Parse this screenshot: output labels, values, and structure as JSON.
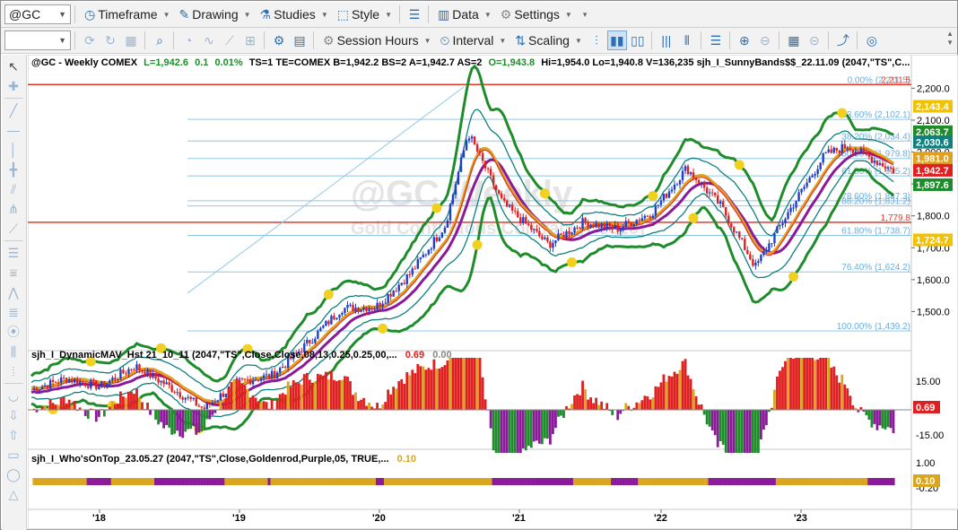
{
  "toolbar1": {
    "symbol": "@GC",
    "items": [
      {
        "label": "Timeframe",
        "icon": "clock-icon"
      },
      {
        "label": "Drawing",
        "icon": "pencil-icon"
      },
      {
        "label": "Studies",
        "icon": "flask-icon"
      },
      {
        "label": "Style",
        "icon": "style-icon"
      },
      {
        "label": "Data",
        "icon": "data-icon"
      },
      {
        "label": "Settings",
        "icon": "gear-icon"
      }
    ]
  },
  "toolbar2": {
    "combo_value": "",
    "items": [
      {
        "label": "Session Hours",
        "icon": "gear-icon"
      },
      {
        "label": "Interval",
        "icon": "interval-icon"
      },
      {
        "label": "Scaling",
        "icon": "scaling-icon"
      }
    ]
  },
  "header": {
    "symbol_text": "@GC - Weekly  COMEX",
    "last": "L=1,942.6",
    "chg": "0.1",
    "pct": "0.01%",
    "rest": "TS=1  TE=COMEX  B=1,942.2  BS=2  A=1,942.7  AS=2",
    "open": "O=1,943.8",
    "rest2": "Hi=1,954.0  Lo=1,940.8  V=136,235  sjh_I_SunnyBands$$_22.11.09 (2047,\"TS\",C..."
  },
  "watermark": {
    "line1": "@GC Weekly",
    "line2": "Gold Continuous Contract [Dec23]"
  },
  "fib_levels": [
    {
      "label": "0.00% (2,211.5)",
      "value": 2211.5
    },
    {
      "label": "23.60% (2,102.1)",
      "value": 2102.1
    },
    {
      "label": "38.20% (2,034.4)",
      "value": 2034.4
    },
    {
      "label": "50.00% (1,979.8)",
      "value": 1979.8
    },
    {
      "label": "61.80% (1,925.2)",
      "value": 1925.2
    },
    {
      "label": "78.60% (1,847.3)",
      "value": 1847.3
    },
    {
      "label": "88.20% (1,831.2)",
      "value": 1831.2
    },
    {
      "label": "61.80% (1,738.7)",
      "value": 1738.7
    },
    {
      "label": "76.40% (1,624.2)",
      "value": 1624.2
    },
    {
      "label": "100.00% (1,439.2)",
      "value": 1439.2
    }
  ],
  "hlines": [
    {
      "label": "2,211.5",
      "value": 2211.5,
      "color": "#e8382b"
    },
    {
      "label": "1,779.8",
      "value": 1779.8,
      "color": "#e8382b"
    }
  ],
  "price_axis": {
    "ticks": [
      "2,200.0",
      "2,100.0",
      "2,000.0",
      "1,900.0",
      "1,800.0",
      "1,700.0",
      "1,600.0",
      "1,500.0"
    ],
    "tick_values": [
      2200,
      2100,
      2000,
      1900,
      1800,
      1700,
      1600,
      1500
    ],
    "min": 1400,
    "max": 2260
  },
  "price_badges": [
    {
      "label": "2,143.4",
      "value": 2143.4,
      "bg": "#f2c200",
      "fg": "#ffffff"
    },
    {
      "label": "2,063.7",
      "value": 2063.7,
      "bg": "#1e8c2a",
      "fg": "#ffffff"
    },
    {
      "label": "2,030.6",
      "value": 2030.6,
      "bg": "#0f8080",
      "fg": "#ffffff"
    },
    {
      "label": "1,981.0",
      "value": 1981.0,
      "bg": "#e0a020",
      "fg": "#ffffff"
    },
    {
      "label": "1,942.7",
      "value": 1942.7,
      "bg": "#e02020",
      "fg": "#ffffff"
    },
    {
      "label": "1,897.6",
      "value": 1897.6,
      "bg": "#1e8c2a",
      "fg": "#ffffff"
    },
    {
      "label": "1,724.7",
      "value": 1724.7,
      "bg": "#f2c200",
      "fg": "#ffffff"
    }
  ],
  "sub1": {
    "title": "sjh_I_DynamicMAV_Hst 21_10_11 (2047,\"TS\",Close,Close,08,13,0.25,0.25,00,...",
    "val1": "0.69",
    "val2": "0.00",
    "ticks": [
      "15.00",
      "-15.00"
    ],
    "badge": "0.69"
  },
  "sub2": {
    "title": "sjh_I_Who'sOnTop_23.05.27 (2047,\"TS\",Close,Goldenrod,Purple,05,  TRUE,...",
    "val1": "0.10",
    "ticks": [
      "1.00",
      "-0.20"
    ],
    "badge": "0.10"
  },
  "time_axis": [
    "'18",
    "'19",
    "'20",
    "'21",
    "'22",
    "'23"
  ],
  "colors": {
    "upper_band": "#1e8c2a",
    "inner_band": "#0f8080",
    "ma_gold": "#e0a020",
    "ma_purple": "#8b1a9a",
    "ma_red": "#e02020",
    "fib": "#8ec8e8",
    "goldenrod": "#daa520",
    "purple": "#8b1a9a"
  },
  "chart_data": {
    "type": "candlestick",
    "title": "@GC - Weekly  COMEX",
    "x": [
      "'18",
      "'19",
      "'20",
      "'21",
      "'22",
      "'23"
    ],
    "close_path": [
      [
        "2017-06",
        1255
      ],
      [
        "2017-09",
        1290
      ],
      [
        "2017-12",
        1265
      ],
      [
        "2018-03",
        1330
      ],
      [
        "2018-06",
        1265
      ],
      [
        "2018-09",
        1195
      ],
      [
        "2018-12",
        1280
      ],
      [
        "2019-03",
        1300
      ],
      [
        "2019-06",
        1400
      ],
      [
        "2019-09",
        1510
      ],
      [
        "2019-12",
        1515
      ],
      [
        "2020-03",
        1620
      ],
      [
        "2020-06",
        1770
      ],
      [
        "2020-08",
        2060
      ],
      [
        "2020-11",
        1840
      ],
      [
        "2021-03",
        1710
      ],
      [
        "2021-06",
        1780
      ],
      [
        "2021-09",
        1760
      ],
      [
        "2021-12",
        1810
      ],
      [
        "2022-03",
        1950
      ],
      [
        "2022-06",
        1830
      ],
      [
        "2022-09",
        1640
      ],
      [
        "2022-12",
        1820
      ],
      [
        "2023-03",
        1990
      ],
      [
        "2023-05",
        2020
      ],
      [
        "2023-09",
        1942.6
      ]
    ],
    "ylim": [
      1400,
      2260
    ],
    "legend": "none"
  }
}
